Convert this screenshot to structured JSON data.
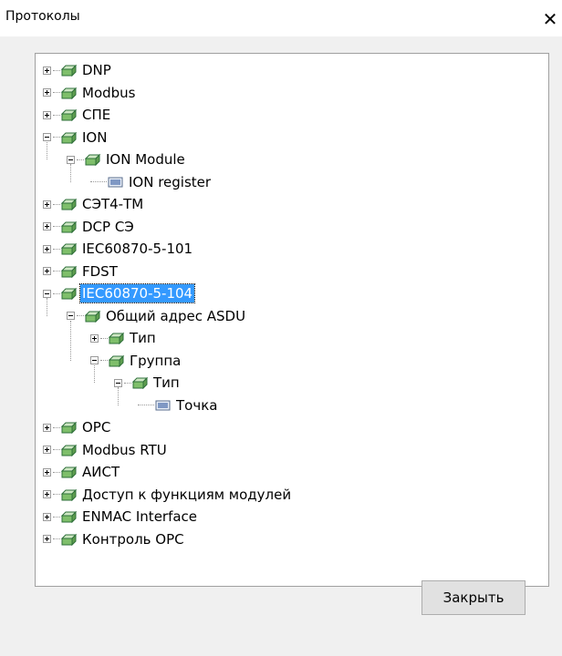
{
  "window": {
    "title": "Протоколы",
    "close_glyph": "✕"
  },
  "tree": [
    {
      "label": "DNP",
      "level": 0,
      "expander": "plus",
      "icon": "protocol-icon"
    },
    {
      "label": "Modbus",
      "level": 0,
      "expander": "plus",
      "icon": "protocol-icon"
    },
    {
      "label": "СПЕ",
      "level": 0,
      "expander": "plus",
      "icon": "protocol-icon"
    },
    {
      "label": "ION",
      "level": 0,
      "expander": "minus",
      "icon": "protocol-icon"
    },
    {
      "label": "ION Module",
      "level": 1,
      "expander": "minus",
      "icon": "protocol-icon"
    },
    {
      "label": "ION register",
      "level": 2,
      "expander": "none",
      "icon": "register-icon"
    },
    {
      "label": "СЭТ4-ТМ",
      "level": 0,
      "expander": "plus",
      "icon": "protocol-icon"
    },
    {
      "label": "DCP СЭ",
      "level": 0,
      "expander": "plus",
      "icon": "protocol-icon"
    },
    {
      "label": "IEC60870-5-101",
      "level": 0,
      "expander": "plus",
      "icon": "protocol-icon"
    },
    {
      "label": "FDST",
      "level": 0,
      "expander": "plus",
      "icon": "protocol-icon"
    },
    {
      "label": "IEC60870-5-104",
      "level": 0,
      "expander": "minus",
      "icon": "protocol-icon",
      "selected": true
    },
    {
      "label": "Общий адрес ASDU",
      "level": 1,
      "expander": "minus",
      "icon": "protocol-icon"
    },
    {
      "label": "Тип",
      "level": 2,
      "expander": "plus",
      "icon": "protocol-icon"
    },
    {
      "label": "Группа",
      "level": 2,
      "expander": "minus",
      "icon": "protocol-icon"
    },
    {
      "label": "Тип",
      "level": 3,
      "expander": "minus",
      "icon": "protocol-icon"
    },
    {
      "label": "Точка",
      "level": 4,
      "expander": "none",
      "icon": "register-icon"
    },
    {
      "label": "OPC",
      "level": 0,
      "expander": "plus",
      "icon": "protocol-icon"
    },
    {
      "label": "Modbus RTU",
      "level": 0,
      "expander": "plus",
      "icon": "protocol-icon"
    },
    {
      "label": "АИСТ",
      "level": 0,
      "expander": "plus",
      "icon": "protocol-icon"
    },
    {
      "label": "Доступ к функциям модулей",
      "level": 0,
      "expander": "plus",
      "icon": "protocol-icon"
    },
    {
      "label": "ENMAC Interface",
      "level": 0,
      "expander": "plus",
      "icon": "protocol-icon"
    },
    {
      "label": "Контроль OPC",
      "level": 0,
      "expander": "plus",
      "icon": "protocol-icon"
    }
  ],
  "buttons": {
    "close_label": "Закрыть"
  }
}
